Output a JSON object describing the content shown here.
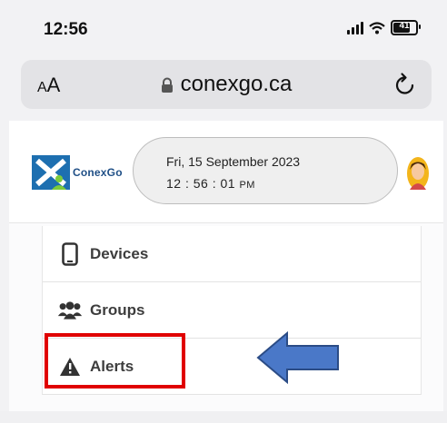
{
  "status_bar": {
    "time": "12:56",
    "battery_level": "41"
  },
  "browser": {
    "text_size_button": "AA",
    "url": "conexgo.ca",
    "reload_icon": "reload-icon",
    "lock_icon": "lock-icon"
  },
  "header": {
    "logo_text": "ConexGo",
    "date": "Fri, 15 September 2023",
    "time": "12 : 56 : 01",
    "ampm": "PM"
  },
  "menu": {
    "items": [
      {
        "label": "Devices",
        "icon": "phone-icon"
      },
      {
        "label": "Groups",
        "icon": "users-icon"
      },
      {
        "label": "Alerts",
        "icon": "warning-icon"
      }
    ]
  },
  "annotations": {
    "highlight_color": "#e00000",
    "arrow_color": "#4a78c8"
  }
}
